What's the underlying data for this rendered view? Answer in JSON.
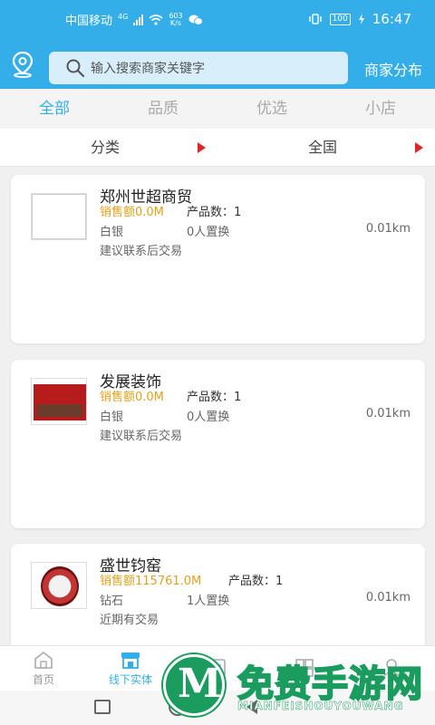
{
  "status_bar": {
    "carrier": "中国移动",
    "network": "4G",
    "speed_value": "603",
    "speed_unit": "K/s",
    "battery": "100",
    "time": "16:47"
  },
  "header": {
    "search_placeholder": "输入搜索商家关键字",
    "distribution_label": "商家分布"
  },
  "tabs": [
    {
      "label": "全部",
      "active": true
    },
    {
      "label": "品质",
      "active": false
    },
    {
      "label": "优选",
      "active": false
    },
    {
      "label": "小店",
      "active": false
    }
  ],
  "filters": {
    "category": "分类",
    "region": "全国"
  },
  "merchants": [
    {
      "name": "郑州世超商贸",
      "sales": "销售额0.0M",
      "products": "产品数：1",
      "level": "白银",
      "swaps": "0人置换",
      "distance": "0.01km",
      "note": "建议联系后交易"
    },
    {
      "name": "发展装饰",
      "sales": "销售额0.0M",
      "products": "产品数：1",
      "level": "白银",
      "swaps": "0人置换",
      "distance": "0.01km",
      "note": "建议联系后交易"
    },
    {
      "name": "盛世钧窑",
      "sales": "销售额115761.0M",
      "products": "产品数：1",
      "level": "钻石",
      "swaps": "1人置换",
      "distance": "0.01km",
      "note": "近期有交易"
    }
  ],
  "bottom_nav": [
    {
      "label": "首页",
      "icon": "home-icon",
      "active": false
    },
    {
      "label": "线下实体",
      "icon": "store-icon",
      "active": true
    },
    {
      "label": "",
      "icon": "document-icon",
      "active": false
    },
    {
      "label": "",
      "icon": "grid-icon",
      "active": false
    },
    {
      "label": "",
      "icon": "user-icon",
      "active": false
    }
  ],
  "watermark": {
    "title": "免费手游网",
    "subtitle": "MIANFEISHOUYOUWANG"
  },
  "colors": {
    "accent": "#33aee9",
    "sales": "#e4a11b",
    "triangle": "#e02424"
  }
}
